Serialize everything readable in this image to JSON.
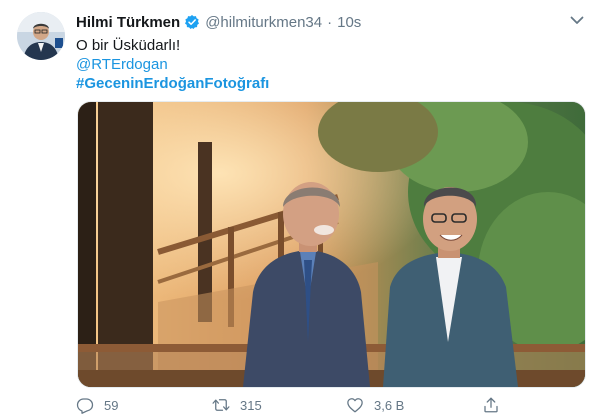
{
  "tweet": {
    "author_name": "Hilmi Türkmen",
    "handle": "@hilmiturkmen34",
    "separator": "·",
    "time": "10s",
    "text_line1": "O bir Üsküdarlı!",
    "mention": "@RTErdogan",
    "hashtag": "#GeceninErdoğanFotoğrafı",
    "replies": "59",
    "retweets": "315",
    "likes": "3,6 B"
  },
  "colors": {
    "link": "#1b95e0",
    "secondary_text": "#657786",
    "primary_text": "#14171a",
    "verified_badge": "#1da1f2"
  },
  "icons": [
    "verified-badge-icon",
    "chevron-down-icon",
    "reply-icon",
    "retweet-icon",
    "like-icon",
    "share-icon"
  ]
}
